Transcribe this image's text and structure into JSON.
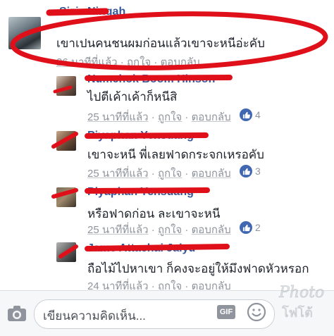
{
  "comments": [
    {
      "author": "Siziz Ningah",
      "text": "เขาเปนคนชนผมก่อนแล้วเขาจะหนีอ่ะคับ",
      "time": "26 นาทีที่แล้ว",
      "like": "ถูกใจ",
      "reply": "ตอบกลับ",
      "likes": ""
    },
    {
      "author": "Numchok Boom Hinson",
      "text": "ไปตีเค้าเค้าก็หนีสิ",
      "time": "25 นาทีที่แล้ว",
      "like": "ถูกใจ",
      "reply": "ตอบกลับ",
      "likes": "4"
    },
    {
      "author": "Piyaphan Yensuang",
      "text": "เขาจะหนี พี่เลยฟาดกระจกเหรอคับ",
      "time": "25 นาทีที่แล้ว",
      "like": "ถูกใจ",
      "reply": "ตอบกลับ",
      "likes": "3"
    },
    {
      "author": "Piyaphan Yensuang",
      "text": "หรือฟาดก่อน ละเขาจะหนี",
      "time": "25 นาทีที่แล้ว",
      "like": "ถูกใจ",
      "reply": "ตอบกลับ",
      "likes": "2"
    },
    {
      "author": "Jame Attachai Jaiyu",
      "text": "ถือไม้ไปหาเขา ก็คงจะอยู่ให้มึงฟาดหัวหรอก",
      "time": "24 นาทีที่แล้ว",
      "like": "ถูกใจ",
      "reply": "ตอบกลับ",
      "likes": ""
    }
  ],
  "input": {
    "placeholder": "เขียนความคิดเห็น...",
    "gif": "GIF"
  },
  "watermark": {
    "line1": "Photo",
    "line2": "โฟโต้"
  },
  "colors": {
    "link": "#365899",
    "meta": "#90949c",
    "like_badge": "#4267b2",
    "annotation": "#e0101a"
  },
  "icons": [
    "camera-icon",
    "smile-icon",
    "thumbs-up-icon"
  ]
}
